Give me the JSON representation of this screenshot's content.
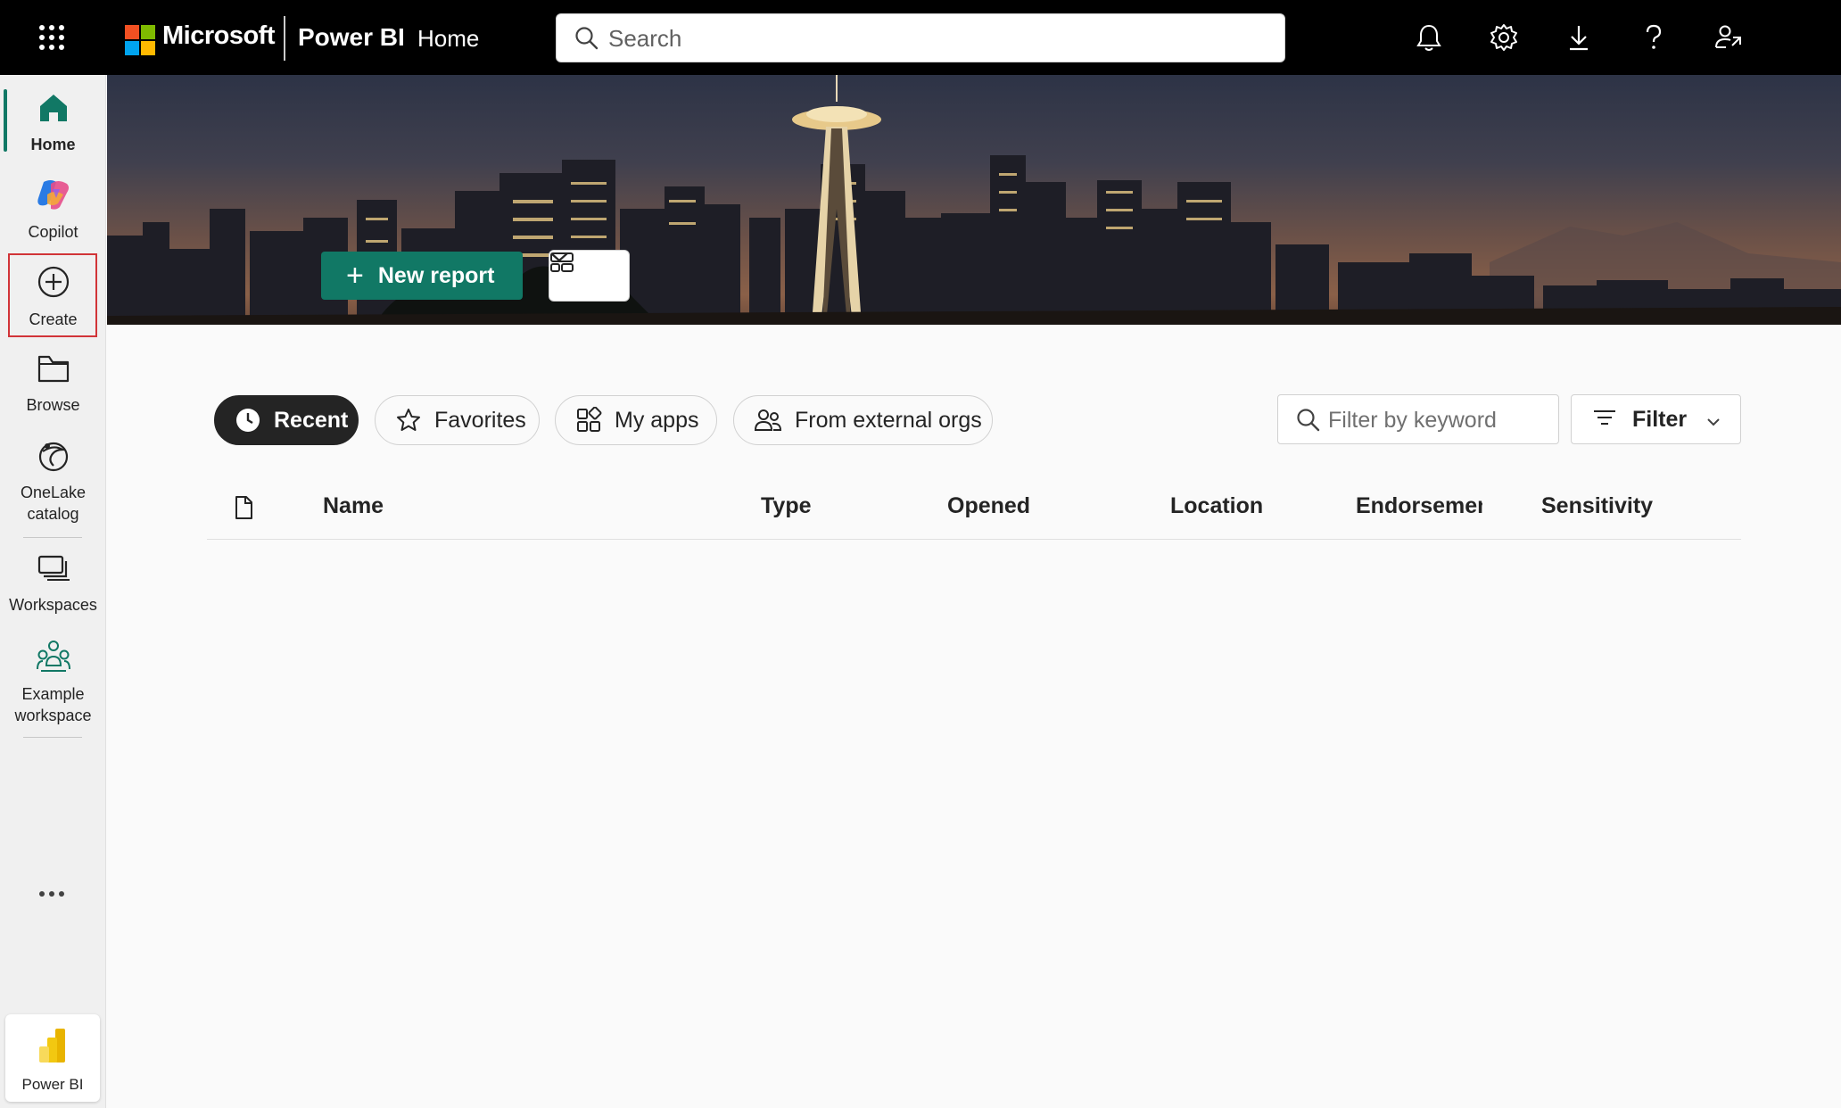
{
  "topbar": {
    "brand": "Microsoft",
    "app_name": "Power BI",
    "breadcrumb": "Home",
    "search_placeholder": "Search",
    "icons": [
      "waffle-icon",
      "bell-icon",
      "gear-icon",
      "download-icon",
      "help-icon",
      "share-person-icon"
    ]
  },
  "sidebar": {
    "items": [
      {
        "label": "Home",
        "icon": "home-icon",
        "active": true
      },
      {
        "label": "Copilot",
        "icon": "copilot-icon"
      },
      {
        "label": "Create",
        "icon": "plus-circle-icon",
        "highlighted": true
      },
      {
        "label": "Browse",
        "icon": "folder-icon"
      },
      {
        "label": "OneLake catalog",
        "label_line1": "OneLake",
        "label_line2": "catalog",
        "icon": "onelake-icon"
      },
      {
        "label": "Workspaces",
        "icon": "workspaces-icon"
      },
      {
        "label": "Example workspace",
        "label_line1": "Example",
        "label_line2": "workspace",
        "icon": "people-group-icon"
      }
    ],
    "more_icon": "more-icon",
    "footer_label": "Power BI"
  },
  "banner": {
    "new_report_label": "New report",
    "layout_icon": "layout-icon"
  },
  "filters": {
    "tabs": [
      {
        "label": "Recent",
        "icon": "clock-icon",
        "selected": true
      },
      {
        "label": "Favorites",
        "icon": "star-icon"
      },
      {
        "label": "My apps",
        "icon": "apps-icon"
      },
      {
        "label": "From external orgs",
        "icon": "people-icon"
      }
    ],
    "keyword_placeholder": "Filter by keyword",
    "filter_label": "Filter"
  },
  "table": {
    "columns": [
      "Name",
      "Type",
      "Opened",
      "Location",
      "Endorsement",
      "Sensitivity"
    ],
    "rows": []
  },
  "colors": {
    "accent": "#117865",
    "create_highlight": "#d13438",
    "topbar_bg": "#000000"
  }
}
